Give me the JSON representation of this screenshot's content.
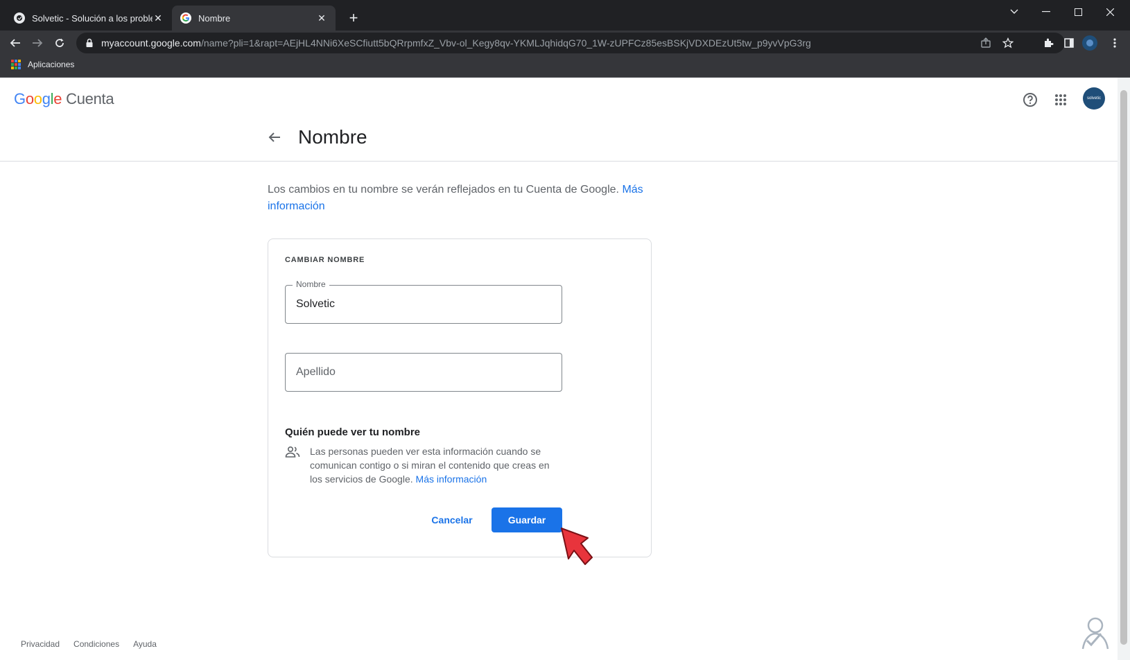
{
  "browser": {
    "tabs": [
      {
        "title": "Solvetic - Solución a los problem",
        "active": false
      },
      {
        "title": "Nombre",
        "active": true
      }
    ],
    "url_host": "myaccount.google.com",
    "url_path": "/name?pli=1&rapt=AEjHL4NNi6XeSCfiutt5bQRrpmfxZ_Vbv-ol_Kegy8qv-YKMLJqhidqG70_1W-zUPFCz85esBSKjVDXDEzUt5tw_p9yvVpG3rg",
    "bookmark": "Aplicaciones"
  },
  "header": {
    "logo_g": "G",
    "logo_o1": "o",
    "logo_o2": "o",
    "logo_g2": "g",
    "logo_l": "l",
    "logo_e": "e",
    "product": "Cuenta",
    "avatar_text": "solvetic"
  },
  "page": {
    "title": "Nombre",
    "intro": "Los cambios en tu nombre se verán reflejados en tu Cuenta de Google.",
    "intro_link": "Más información"
  },
  "card": {
    "heading": "CAMBIAR NOMBRE",
    "name_label": "Nombre",
    "name_value": "Solvetic",
    "surname_placeholder": "Apellido",
    "who_title": "Quién puede ver tu nombre",
    "who_text": "Las personas pueden ver esta información cuando se comunican contigo o si miran el contenido que creas en los servicios de Google.",
    "who_link": "Más información",
    "cancel": "Cancelar",
    "save": "Guardar"
  },
  "footer": {
    "links": [
      "Privacidad",
      "Condiciones",
      "Ayuda"
    ]
  },
  "colors": {
    "accent": "#1a73e8",
    "chrome_dark": "#202124",
    "chrome_mid": "#35363a"
  }
}
